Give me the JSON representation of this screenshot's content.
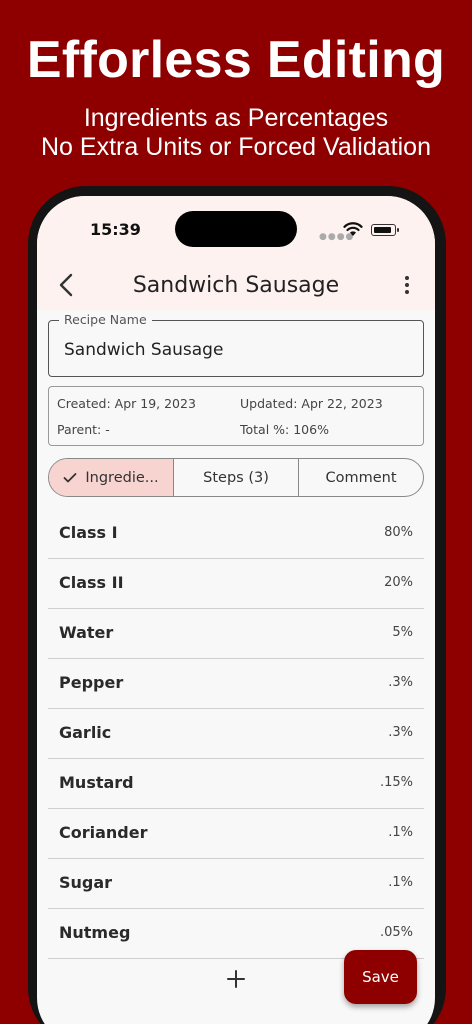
{
  "promo": {
    "title": "Efforless Editing",
    "subtitle_line1": "Ingredients as Percentages",
    "subtitle_line2": "No Extra Units or Forced Validation"
  },
  "status_bar": {
    "time": "15:39"
  },
  "app_bar": {
    "title": "Sandwich Sausage"
  },
  "recipe_name": {
    "label": "Recipe Name",
    "value": "Sandwich Sausage"
  },
  "meta": {
    "created": "Created: Apr 19, 2023",
    "updated": "Updated: Apr 22, 2023",
    "parent": "Parent: -",
    "total": "Total %: 106%"
  },
  "tabs": [
    {
      "label": "Ingredie...",
      "selected": true
    },
    {
      "label": "Steps (3)",
      "selected": false
    },
    {
      "label": "Comment",
      "selected": false
    }
  ],
  "ingredients": [
    {
      "name": "Class I",
      "pct": "80%"
    },
    {
      "name": "Class II",
      "pct": "20%"
    },
    {
      "name": "Water",
      "pct": "5%"
    },
    {
      "name": "Pepper",
      "pct": ".3%"
    },
    {
      "name": "Garlic",
      "pct": ".3%"
    },
    {
      "name": "Mustard",
      "pct": ".15%"
    },
    {
      "name": "Coriander",
      "pct": ".1%"
    },
    {
      "name": "Sugar",
      "pct": ".1%"
    },
    {
      "name": "Nutmeg",
      "pct": ".05%"
    }
  ],
  "actions": {
    "save_label": "Save"
  },
  "colors": {
    "accent": "#8e0000",
    "selected_tab": "#f8d4d0",
    "header_tint": "#fdf2f0"
  },
  "icons": [
    "back-arrow-icon",
    "more-vert-icon",
    "check-icon",
    "add-icon",
    "wifi-icon",
    "battery-icon"
  ]
}
